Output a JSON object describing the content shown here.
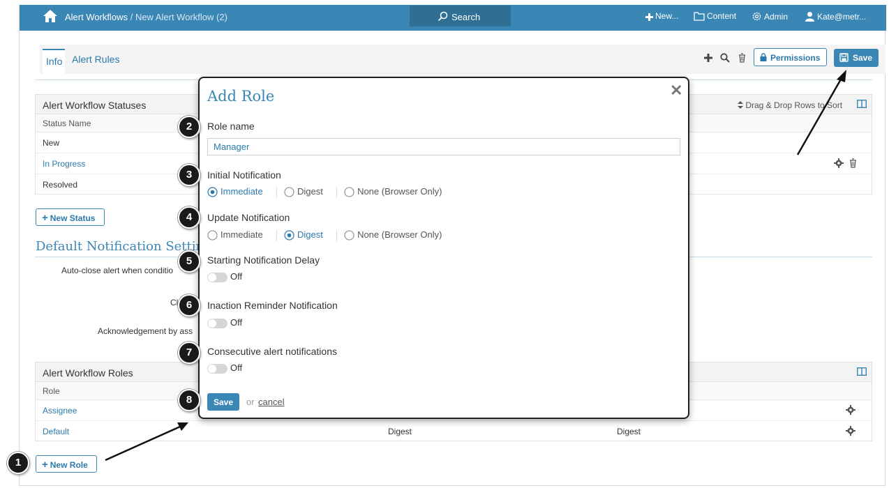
{
  "nav": {
    "breadcrumb_root": "Alert Workflows",
    "breadcrumb_sep": "/",
    "breadcrumb_current": "New Alert Workflow (2)",
    "search": "Search",
    "new": "New...",
    "content": "Content",
    "admin": "Admin",
    "user": "Kate@metr..."
  },
  "tabs": {
    "info": "Info",
    "alert_rules": "Alert Rules"
  },
  "toolbar": {
    "permissions": "Permissions",
    "save": "Save"
  },
  "statuses": {
    "title": "Alert Workflow Statuses",
    "sort_hint": "Drag & Drop Rows to Sort",
    "column": "Status Name",
    "rows": [
      "New",
      "In Progress",
      "Resolved"
    ],
    "new_status": "New Status"
  },
  "defaults": {
    "title": "Default Notification Settings",
    "auto_close": "Auto-close alert when conditio",
    "cl": "Cl",
    "ack": "Acknowledgement by ass"
  },
  "roles": {
    "title": "Alert Workflow Roles",
    "column": "Role",
    "rows": [
      {
        "name": "Assignee",
        "initial": "",
        "update": ""
      },
      {
        "name": "Default",
        "initial": "Digest",
        "update": "Digest"
      }
    ],
    "new_role": "New Role"
  },
  "modal": {
    "title": "Add Role",
    "role_name_label": "Role name",
    "role_name_value": "Manager",
    "initial_label": "Initial Notification",
    "update_label": "Update Notification",
    "options": [
      "Immediate",
      "Digest",
      "None (Browser Only)"
    ],
    "initial_selected": "Immediate",
    "update_selected": "Digest",
    "start_delay_label": "Starting Notification Delay",
    "inaction_label": "Inaction Reminder Notification",
    "consecutive_label": "Consecutive alert notifications",
    "toggle_off": "Off",
    "save": "Save",
    "or": "or",
    "cancel": "cancel"
  },
  "badges": [
    "1",
    "2",
    "3",
    "4",
    "5",
    "6",
    "7",
    "8"
  ],
  "colors": {
    "brand": "#3a86b4",
    "brand_dark": "#2f6f95",
    "link": "#2a79ad"
  }
}
